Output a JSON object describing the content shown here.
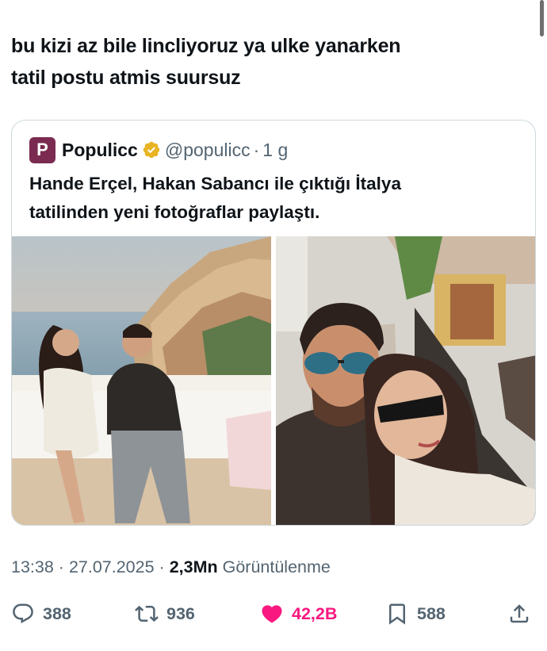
{
  "tweet": {
    "text_line1": "bu kizi az bile lincliyoruz ya ulke yanarken",
    "text_line2": "tatil postu atmis suursuz"
  },
  "quoted_tweet": {
    "avatar_letter": "P",
    "display_name": "Populicc",
    "handle": "@populicc",
    "separator": "·",
    "time": "1 g",
    "text_line1": "Hande Erçel, Hakan Sabancı ile çıktığı İtalya",
    "text_line2": "tatilinden yeni fotoğraflar paylaştı.",
    "verified_color": "#e8b423",
    "avatar_color": "#7b2b4f"
  },
  "meta": {
    "time": "13:38",
    "sep1": "·",
    "date": "27.07.2025",
    "sep2": "·",
    "views_count": "2,3Mn",
    "views_label": "Görüntülenme"
  },
  "actions": {
    "replies": "388",
    "reposts": "936",
    "likes": "42,2B",
    "bookmarks": "588",
    "like_color": "#f91880",
    "icon_names": [
      "reply-icon",
      "repost-icon",
      "like-icon",
      "bookmark-icon",
      "share-icon"
    ]
  }
}
